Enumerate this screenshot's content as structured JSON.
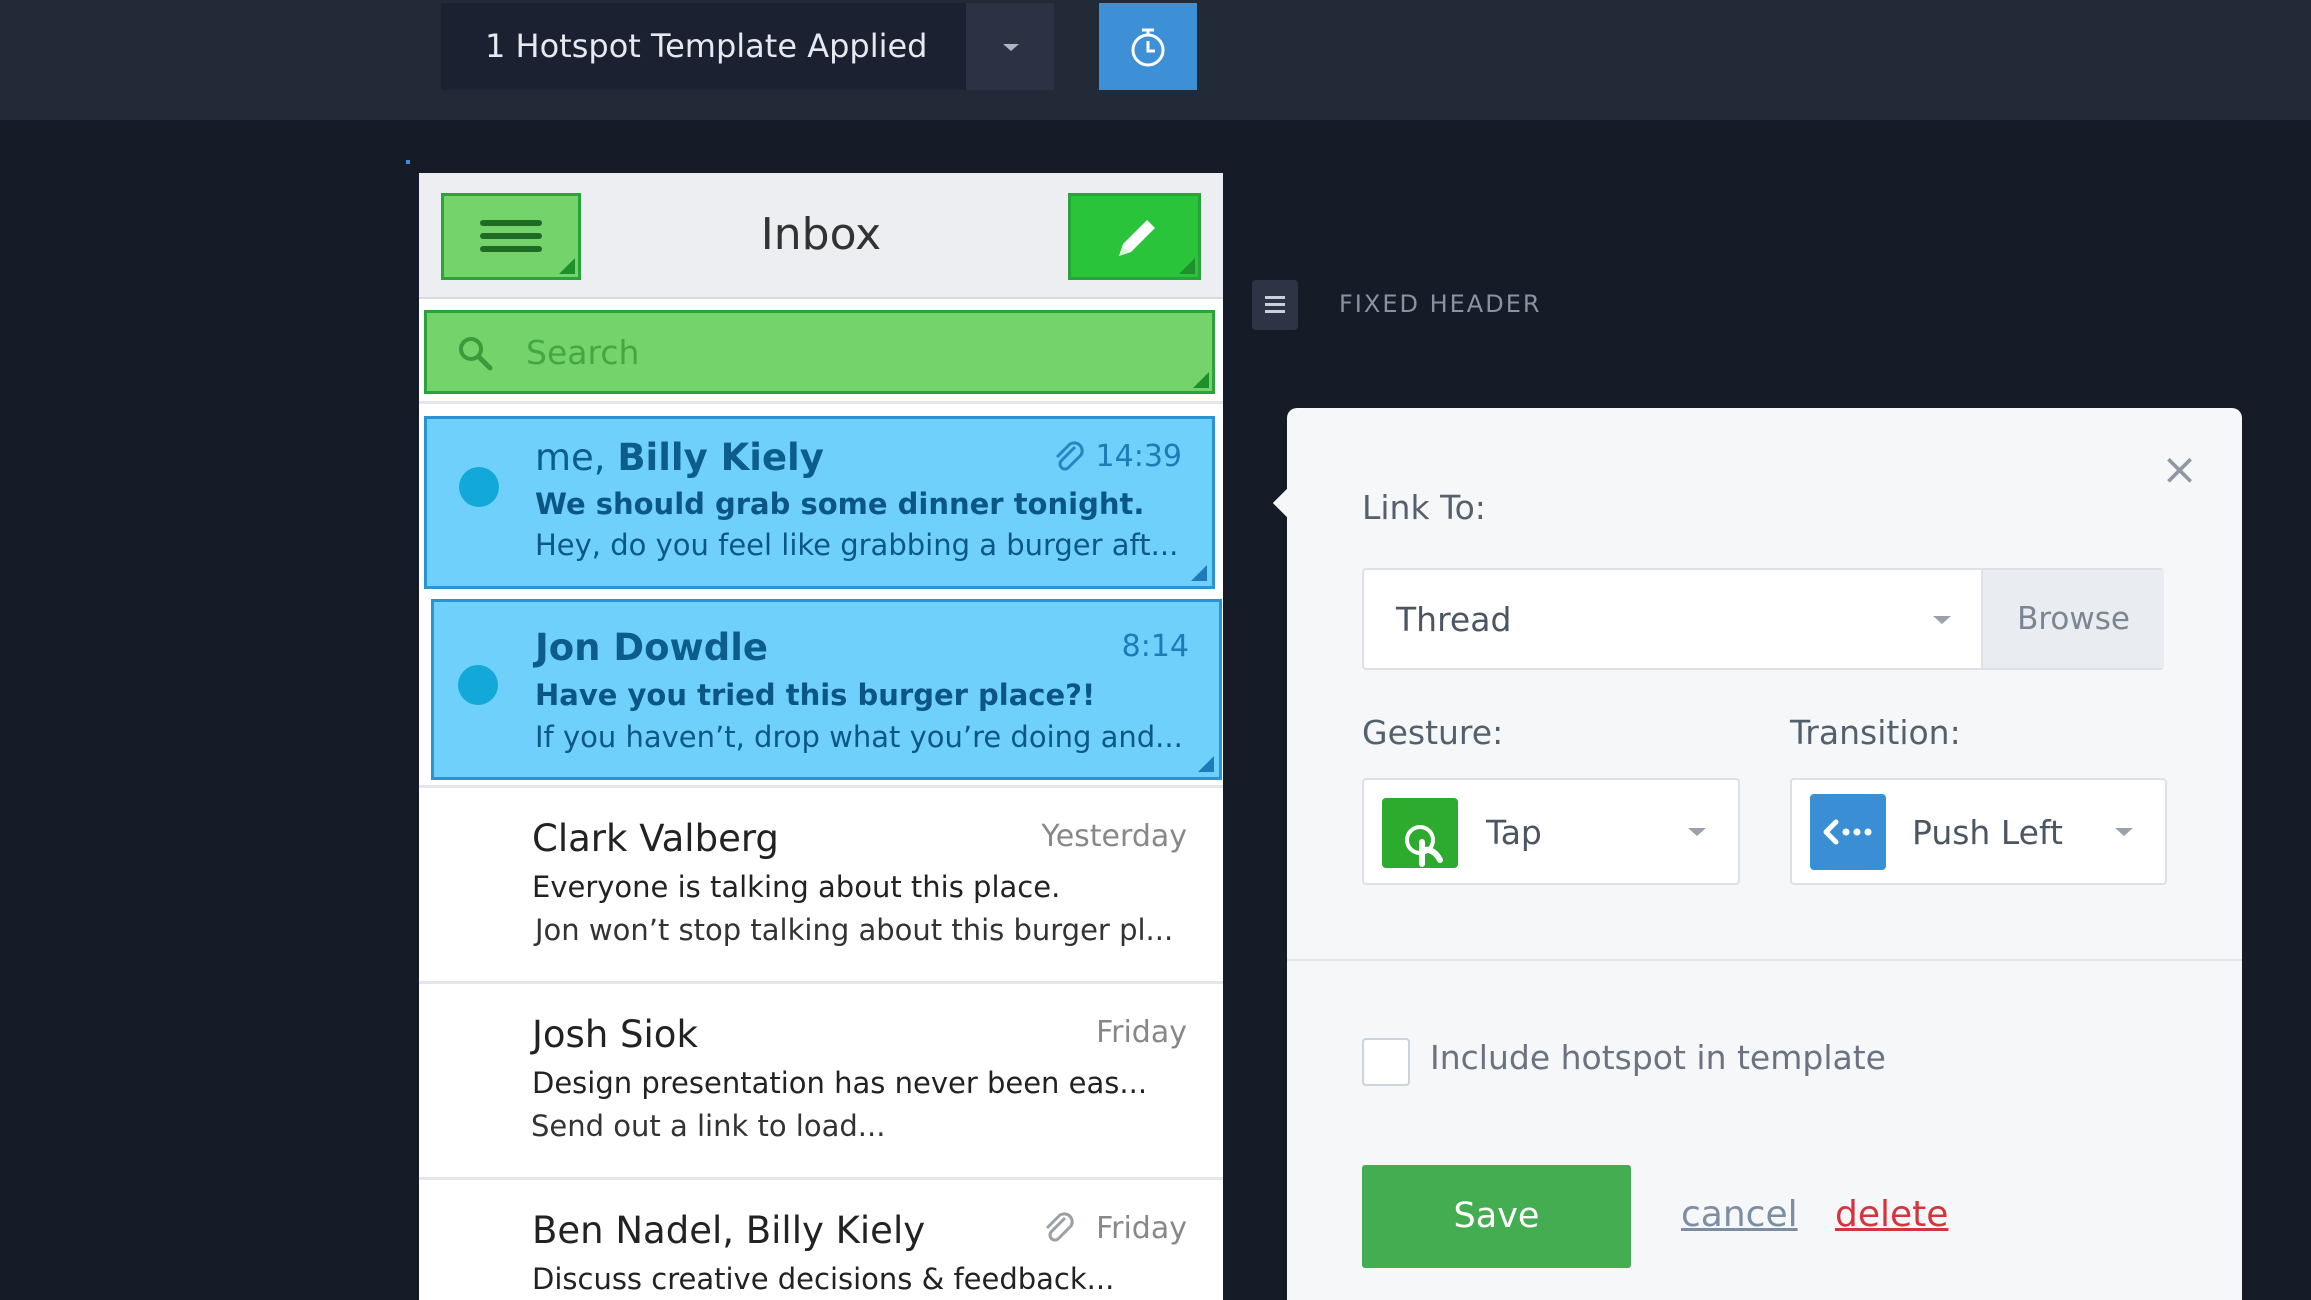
{
  "topbar": {
    "template_label": "1 Hotspot Template Applied",
    "timer_icon": "stopwatch-icon"
  },
  "phone": {
    "title": "Inbox",
    "search_placeholder": "Search",
    "messages": [
      {
        "from_prefix": "me, ",
        "from_bold": "Billy Kiely",
        "time": "14:39",
        "subject": "We should grab some dinner tonight.",
        "preview": "Hey, do you feel like grabbing a burger aft...",
        "attachment": true,
        "unread": true
      },
      {
        "from": "Jon Dowdle",
        "time": "8:14",
        "subject": "Have you tried this burger place?!",
        "preview": "If you haven’t, drop what you’re doing and...",
        "unread": true
      },
      {
        "from": "Clark Valberg",
        "time": "Yesterday",
        "subject": "Everyone is talking about this place.",
        "preview": "Jon won’t stop talking about this burger pl..."
      },
      {
        "from": "Josh Siok",
        "time": "Friday",
        "subject": "Design presentation has never been eas...",
        "preview": "Send out a link to load..."
      },
      {
        "from": "Ben Nadel, Billy Kiely",
        "time": "Friday",
        "subject": "Discuss creative decisions & feedback...",
        "attachment": true
      }
    ]
  },
  "fixed_header": {
    "label": "FIXED HEADER"
  },
  "panel": {
    "link_to_label": "Link To:",
    "link_to_value": "Thread",
    "browse_label": "Browse",
    "gesture_label": "Gesture:",
    "gesture_value": "Tap",
    "transition_label": "Transition:",
    "transition_value": "Push Left",
    "include_label": "Include hotspot in template",
    "include_checked": false,
    "save_label": "Save",
    "cancel_label": "cancel",
    "delete_label": "delete",
    "close_glyph": "×"
  },
  "colors": {
    "hotspot_green": "#74d46b",
    "hotspot_selected_blue": "#6fd0fc",
    "save_green": "#45ad51",
    "delete_red": "#d6343c",
    "accent_blue": "#3d8fd6"
  }
}
